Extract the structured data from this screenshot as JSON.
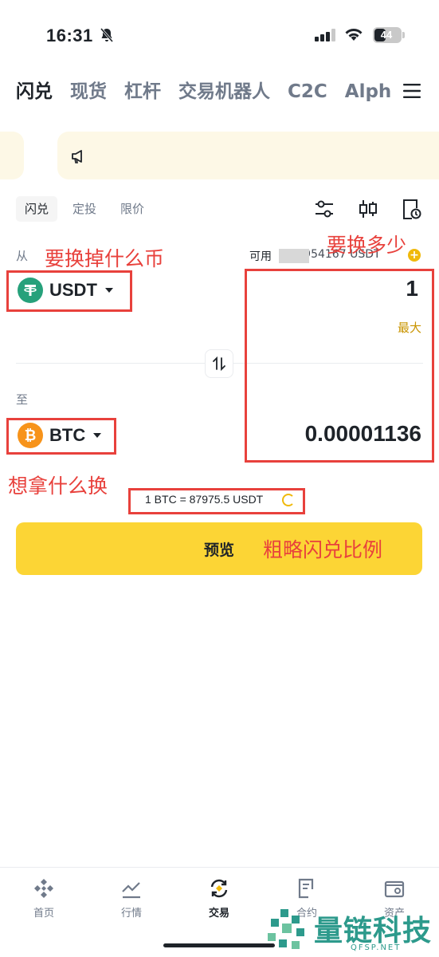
{
  "status_bar": {
    "time": "16:31",
    "battery": "44",
    "battery_level": 0.44
  },
  "top_tabs": [
    {
      "label": "闪兑",
      "active": true
    },
    {
      "label": "现货",
      "active": false
    },
    {
      "label": "杠杆",
      "active": false
    },
    {
      "label": "交易机器人",
      "active": false
    },
    {
      "label": "C2C",
      "active": false
    },
    {
      "label": "Alph",
      "active": false
    }
  ],
  "mode_tabs": [
    {
      "label": "闪兑",
      "active": true
    },
    {
      "label": "定投",
      "active": false
    },
    {
      "label": "限价",
      "active": false
    }
  ],
  "from": {
    "label": "从",
    "available_label": "可用",
    "available_value": "5·26954167 USDT",
    "coin": "USDT",
    "amount": "1",
    "max_label": "最大"
  },
  "to": {
    "label": "至",
    "coin": "BTC",
    "amount": "0.00001136"
  },
  "rate": "1 BTC = 87975.5 USDT",
  "preview_button": "预览",
  "annotations": {
    "from_coin": "要换掉什么币",
    "amount": "要换多少",
    "to_coin": "想拿什么换",
    "rate": "粗略闪兑比例"
  },
  "bottom_nav": [
    {
      "label": "首页",
      "icon": "home-icon",
      "active": false
    },
    {
      "label": "行情",
      "icon": "markets-icon",
      "active": false
    },
    {
      "label": "交易",
      "icon": "trade-icon",
      "active": true
    },
    {
      "label": "合约",
      "icon": "futures-icon",
      "active": false
    },
    {
      "label": "资产",
      "icon": "wallet-icon",
      "active": false
    }
  ],
  "watermark": {
    "title": "量链科技",
    "site": "QFSP.NET"
  },
  "colors": {
    "accent": "#fcd535",
    "annotation": "#e8413c",
    "usdt": "#26a17b",
    "btc": "#f7931a",
    "max_link": "#c99400"
  }
}
